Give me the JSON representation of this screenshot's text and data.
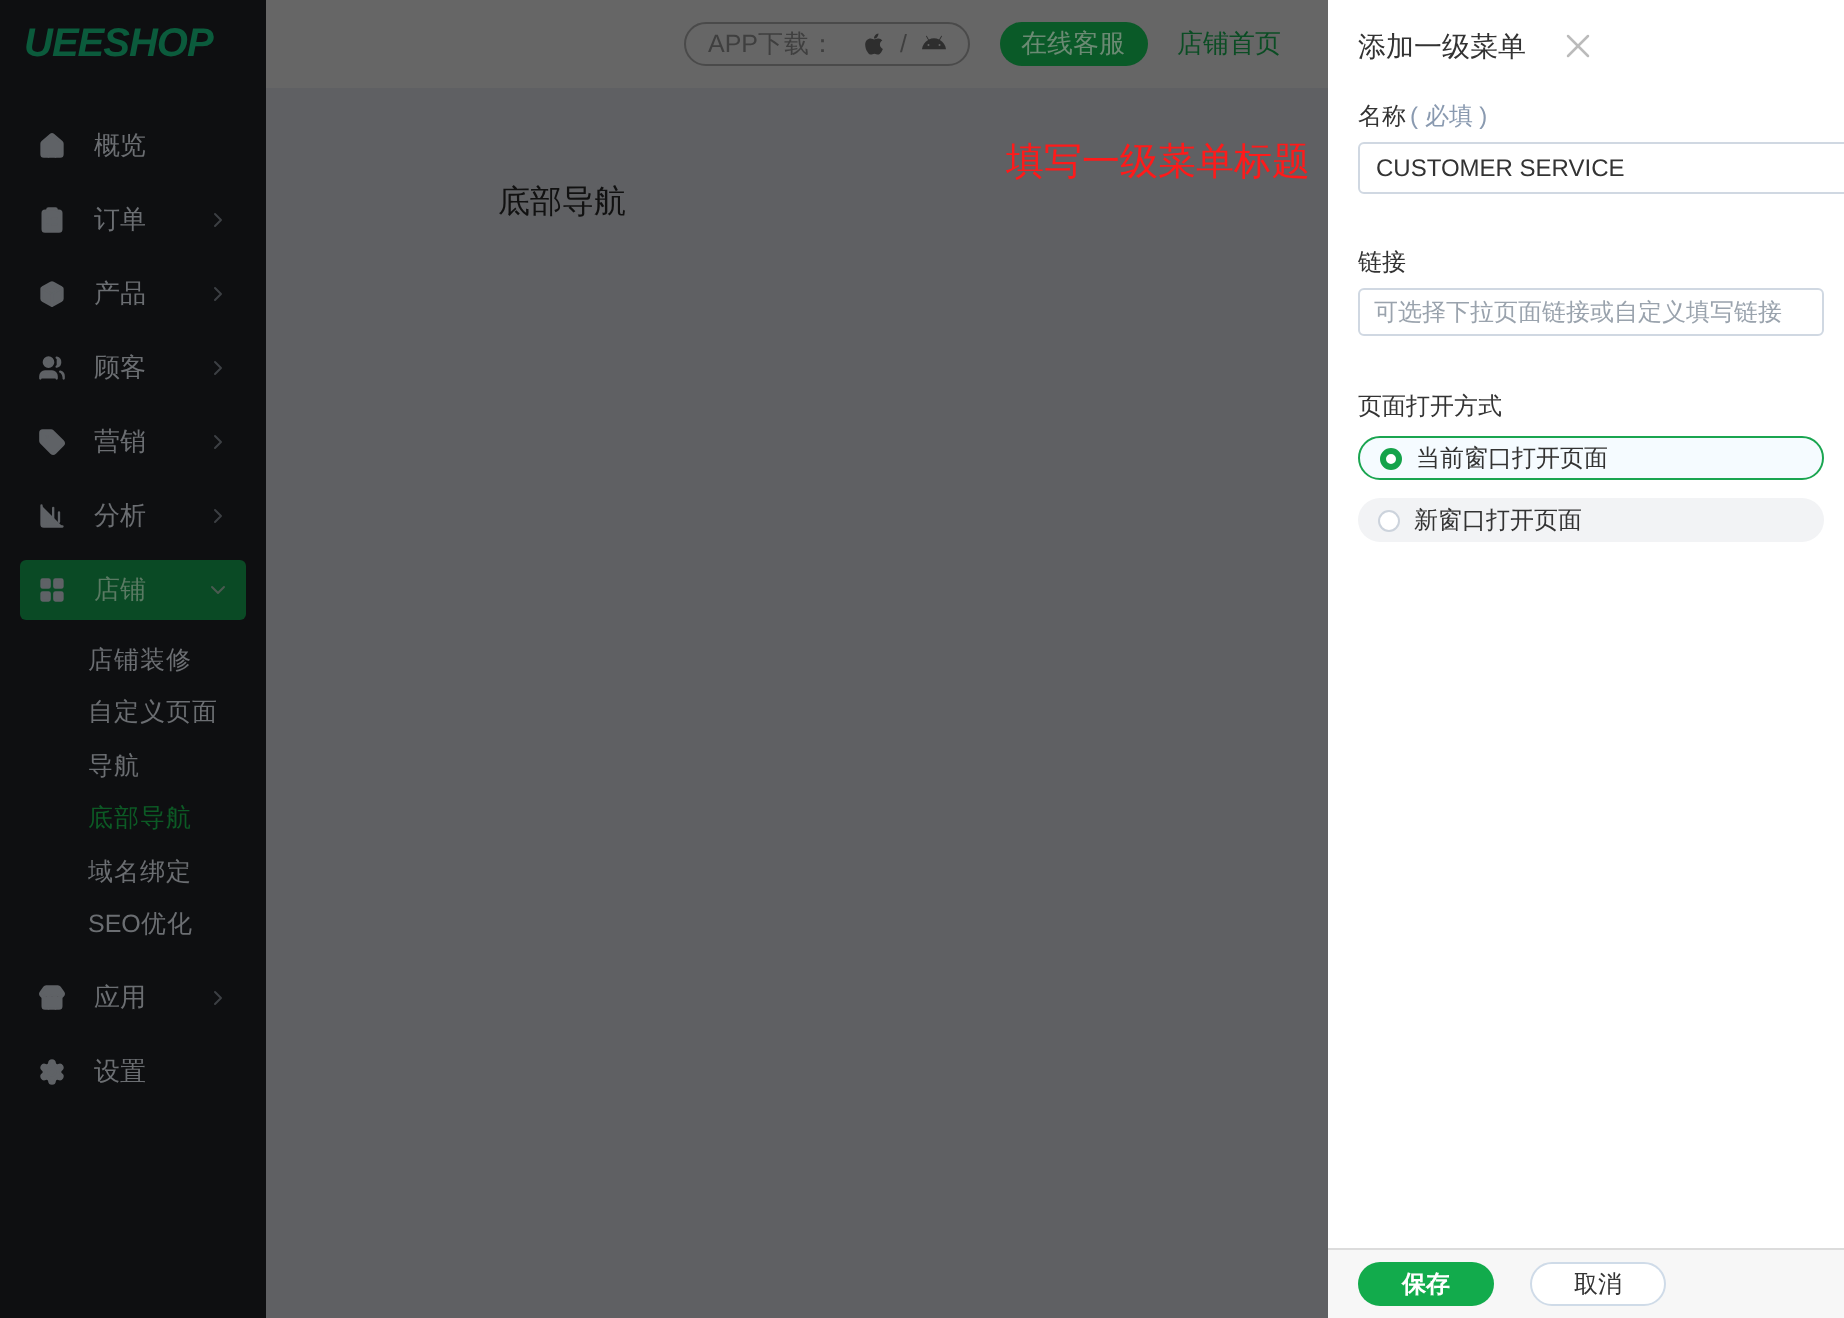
{
  "logo": "UEESHOP",
  "sidebar": {
    "items": [
      {
        "label": "概览",
        "expandable": false,
        "expanded": false,
        "selected": false
      },
      {
        "label": "订单",
        "expandable": true,
        "expanded": false,
        "selected": false
      },
      {
        "label": "产品",
        "expandable": true,
        "expanded": false,
        "selected": false
      },
      {
        "label": "顾客",
        "expandable": true,
        "expanded": false,
        "selected": false
      },
      {
        "label": "营销",
        "expandable": true,
        "expanded": false,
        "selected": false
      },
      {
        "label": "分析",
        "expandable": true,
        "expanded": false,
        "selected": false
      },
      {
        "label": "店铺",
        "expandable": true,
        "expanded": true,
        "selected": true,
        "children": [
          {
            "label": "店铺装修",
            "selected": false
          },
          {
            "label": "自定义页面",
            "selected": false
          },
          {
            "label": "导航",
            "selected": false
          },
          {
            "label": "底部导航",
            "selected": true
          },
          {
            "label": "域名绑定",
            "selected": false
          },
          {
            "label": "SEO优化",
            "selected": false
          }
        ]
      },
      {
        "label": "应用",
        "expandable": true,
        "expanded": false,
        "selected": false
      },
      {
        "label": "设置",
        "expandable": false,
        "expanded": false,
        "selected": false
      }
    ]
  },
  "header": {
    "app_download": {
      "label": "APP下载：",
      "separator": "/"
    },
    "links": [
      {
        "label": "在线客服",
        "kind": "primary"
      },
      {
        "label": "店铺首页",
        "kind": "link"
      }
    ]
  },
  "page_title": "底部导航",
  "annotation": "填写一级菜单标题",
  "drawer": {
    "title": "添加一级菜单",
    "name_field": {
      "label": "名称",
      "required_note": "( 必填 )",
      "value": "CUSTOMER SERVICE"
    },
    "link_field": {
      "label": "链接",
      "placeholder": "可选择下拉页面链接或自定义填写链接"
    },
    "open_mode": {
      "label": "页面打开方式",
      "options": [
        {
          "label": "当前窗口打开页面",
          "selected": true
        },
        {
          "label": "新窗口打开页面",
          "selected": false
        }
      ]
    },
    "buttons": [
      {
        "label": "保存",
        "kind": "primary"
      },
      {
        "label": "取消",
        "kind": "secondary"
      }
    ]
  }
}
